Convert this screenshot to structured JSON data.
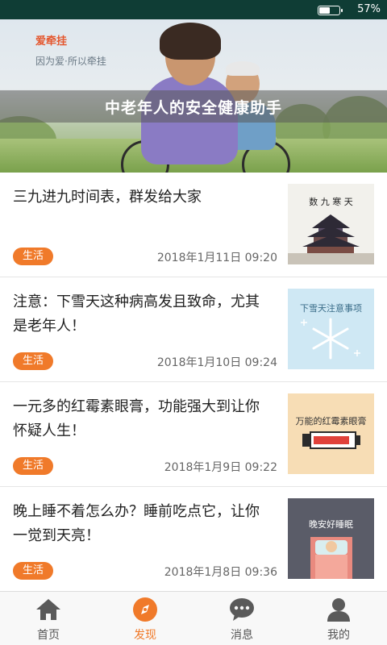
{
  "status_bar": {
    "battery_percent": "57%",
    "battery_level": 0.57
  },
  "banner": {
    "brand": "爱牵挂",
    "slogan": "因为爱·所以牵挂",
    "title": "中老年人的安全健康助手"
  },
  "articles": [
    {
      "title": "三九进九时间表，群发给大家",
      "tag": "生活",
      "date": "2018年1月11日 09:20",
      "thumb_caption": "数 九 寒 天"
    },
    {
      "title": "注意：下雪天这种病高发且致命，尤其是老年人！",
      "tag": "生活",
      "date": "2018年1月10日 09:24",
      "thumb_caption": "下雪天注意事项"
    },
    {
      "title": "一元多的红霉素眼膏，功能强大到让你怀疑人生！",
      "tag": "生活",
      "date": "2018年1月9日 09:22",
      "thumb_caption": "万能的红霉素眼膏"
    },
    {
      "title": "晚上睡不着怎么办？睡前吃点它，让你一觉到天亮！",
      "tag": "生活",
      "date": "2018年1月8日 09:36",
      "thumb_caption": "晚安好睡眠"
    }
  ],
  "tabs": [
    {
      "label": "首页",
      "icon": "home-icon",
      "active": false
    },
    {
      "label": "发现",
      "icon": "compass-icon",
      "active": true
    },
    {
      "label": "消息",
      "icon": "chat-bubble-icon",
      "active": false
    },
    {
      "label": "我的",
      "icon": "person-icon",
      "active": false
    }
  ],
  "colors": {
    "accent": "#f07a2a",
    "status_bar": "#0f3d35",
    "icon_gray": "#5a5a5a"
  }
}
